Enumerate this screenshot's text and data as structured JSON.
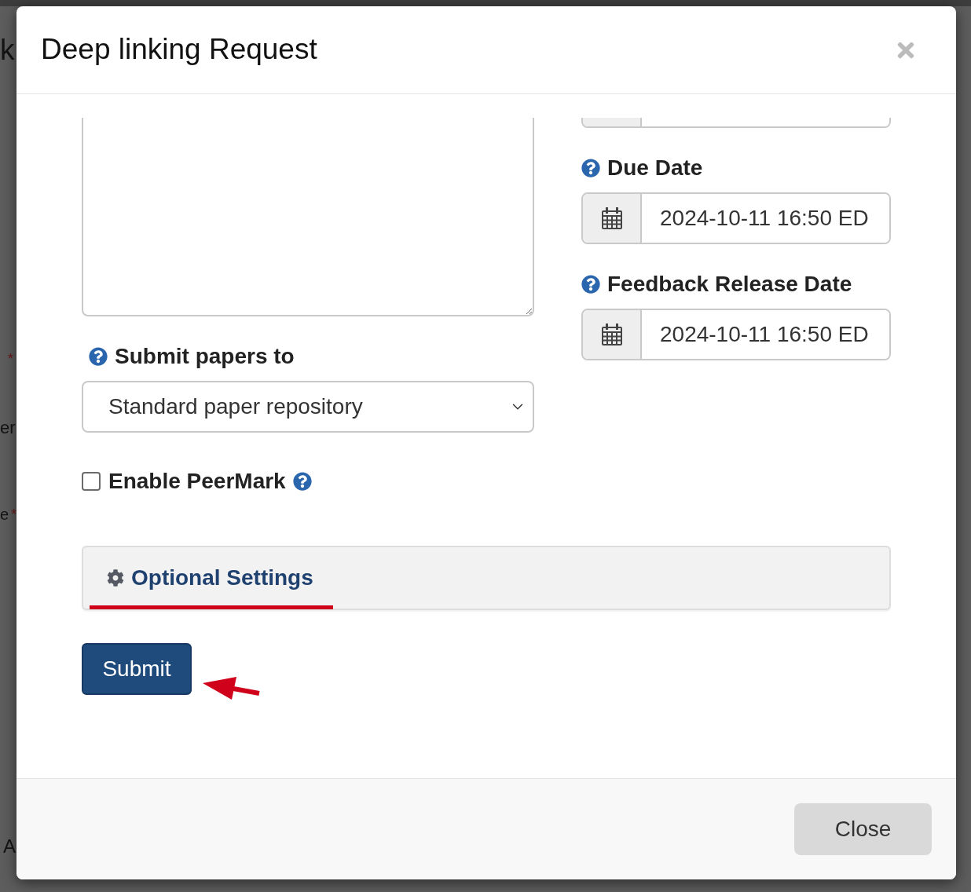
{
  "backdrop": {
    "fragments": [
      {
        "text": "k"
      },
      {
        "mark": "*"
      },
      {
        "text": "er"
      },
      {
        "text": "e",
        "mark": "*"
      },
      {
        "text": "A"
      }
    ]
  },
  "dialog": {
    "title": "Deep linking Request",
    "left_column": {
      "submit_papers_to": {
        "label": "Submit papers to",
        "value": "Standard paper repository"
      },
      "peermark": {
        "label": "Enable PeerMark",
        "checked": false
      }
    },
    "right_column": {
      "dates": [
        {
          "label": "Due Date",
          "value": "2024-10-11 16:50 ED"
        },
        {
          "label": "Feedback Release Date",
          "value": "2024-10-11 16:50 ED"
        }
      ]
    },
    "optional_settings": {
      "label": "Optional Settings",
      "annotation": {
        "kind": "underline"
      }
    },
    "submit_button": {
      "label": "Submit",
      "annotation": {
        "kind": "arrow"
      }
    },
    "footer": {
      "close_button": "Close"
    }
  }
}
